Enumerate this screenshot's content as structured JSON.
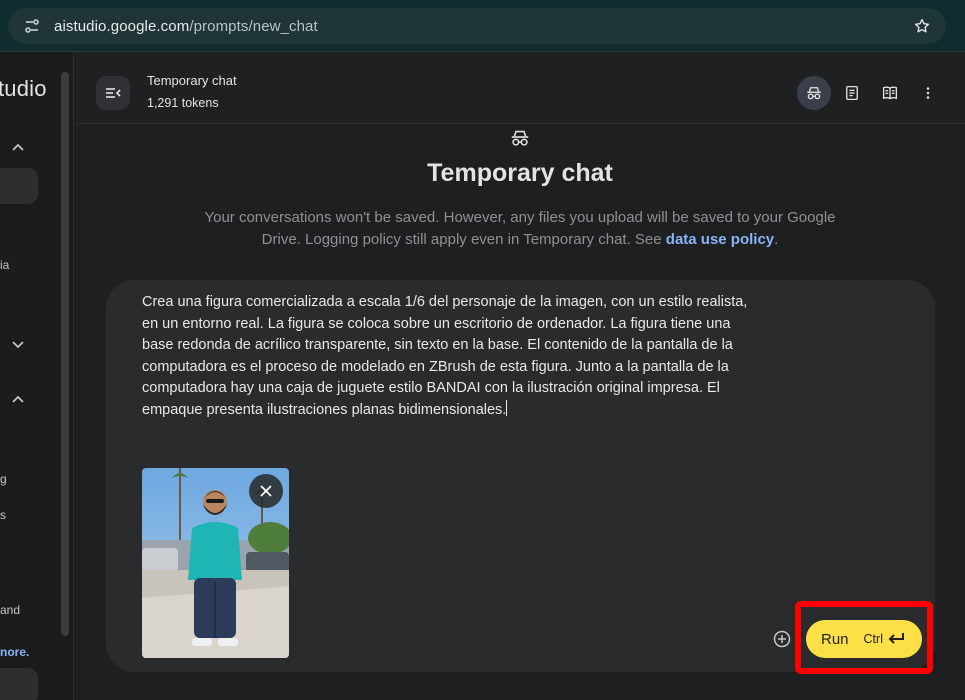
{
  "browser": {
    "url_host": "aistudio.google.com",
    "url_path": "/prompts/new_chat"
  },
  "sidebar": {
    "brand_fragment": "tudio",
    "fragments": [
      "ia",
      "g",
      "s",
      "and",
      "nore."
    ]
  },
  "header": {
    "title": "Temporary chat",
    "tokens": "1,291 tokens"
  },
  "hero": {
    "title": "Temporary chat",
    "description_before": "Your conversations won't be saved. However, any files you upload will be saved to your Google Drive. Logging policy still apply even in Temporary chat. See ",
    "link": "data use policy",
    "description_after": "."
  },
  "composer": {
    "prompt_text": "Crea una figura comercializada a escala 1/6 del personaje de la imagen, con un estilo realista, en un entorno real. La figura se coloca sobre un escritorio de ordenador. La figura tiene una base redonda de acrílico transparente, sin texto en la base. El contenido de la pantalla de la computadora es el proceso de modelado en ZBrush de esta figura. Junto a la pantalla de la computadora hay una caja de juguete estilo BANDAI con la ilustración original impresa. El empaque presenta ilustraciones planas bidimensionales.",
    "run_label": "Run",
    "run_shortcut": "Ctrl"
  },
  "colors": {
    "accent_run": "#fde047",
    "highlight": "#ff0000",
    "link": "#8ab4f8"
  },
  "icons": [
    "tune-icon",
    "star-icon",
    "sidebar-toggle-icon",
    "incognito-icon",
    "notes-icon",
    "compare-icon",
    "more-vert-icon",
    "close-icon",
    "add-circle-icon",
    "enter-icon",
    "chevron-up-icon",
    "chevron-down-icon"
  ]
}
